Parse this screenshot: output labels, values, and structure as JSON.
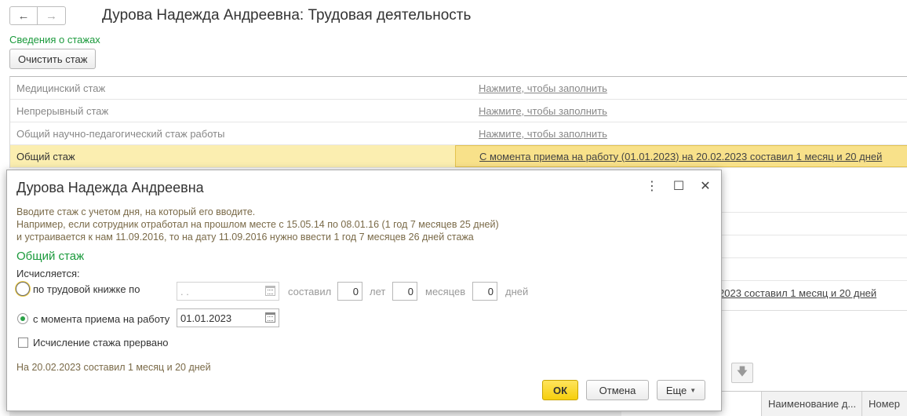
{
  "nav": {
    "back": "🡐",
    "forward": "🡒"
  },
  "page": {
    "title": "Дурова Надежда Андреевна: Трудовая деятельность"
  },
  "section": {
    "title": "Сведения о стажах",
    "clear_button": "Очистить стаж"
  },
  "stazh_rows": [
    {
      "name": "Медицинский стаж",
      "value": "Нажмите, чтобы заполнить"
    },
    {
      "name": "Непрерывный стаж",
      "value": "Нажмите, чтобы заполнить"
    },
    {
      "name": "Общий научно-педагогический стаж работы",
      "value": "Нажмите, чтобы заполнить"
    },
    {
      "name": "Общий стаж",
      "value": "С момента приема на работу (01.01.2023) на 20.02.2023 составил 1 месяц и 20 дней"
    }
  ],
  "background": {
    "total_value_tail": "2023 составил 1 месяц и 20 дней",
    "table_headers": [
      "Наименование д...",
      "Номер"
    ]
  },
  "dialog": {
    "title": "Дурова Надежда Андреевна",
    "hint": [
      "Вводите стаж с учетом дня, на который его вводите.",
      "Например, если сотрудник отработал на прошлом месте с 15.05.14 по 08.01.16 (1 год 7 месяцев 25 дней)",
      "и устраивается к нам 11.09.2016, то на дату 11.09.2016 нужно ввести 1 год 7 месяцев 26 дней стажа"
    ],
    "subtitle": "Общий стаж",
    "calc_label": "Исчисляется:",
    "option_book": {
      "label": "по трудовой книжке по",
      "date": " .  .",
      "sostavil": "составил",
      "years": "0",
      "years_label": "лет",
      "months": "0",
      "months_label": "месяцев",
      "days": "0",
      "days_label": "дней"
    },
    "option_hire": {
      "label": "с момента приема на работу",
      "date": "01.01.2023",
      "selected": true
    },
    "interrupted_label": "Исчисление стажа прервано",
    "interrupted_checked": false,
    "result": "На 20.02.2023 составил 1 месяц и 20 дней",
    "buttons": {
      "ok": "ОК",
      "cancel": "Отмена",
      "more": "Еще"
    }
  },
  "colors": {
    "accent_green": "#1b9a3c",
    "selection": "#fbeeb0",
    "ok_button": "#f6cf0d"
  }
}
